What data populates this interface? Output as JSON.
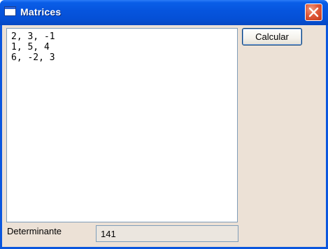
{
  "window": {
    "title": "Matrices"
  },
  "matrix_input": {
    "value": "2, 3, -1\n1, 5, 4\n6, -2, 3"
  },
  "buttons": {
    "calculate_label": "Calcular"
  },
  "result": {
    "label": "Determinante",
    "value": "141"
  },
  "colors": {
    "titlebar": "#0654DD",
    "client_bg": "#ECE1D6",
    "close_button": "#E0593A"
  }
}
